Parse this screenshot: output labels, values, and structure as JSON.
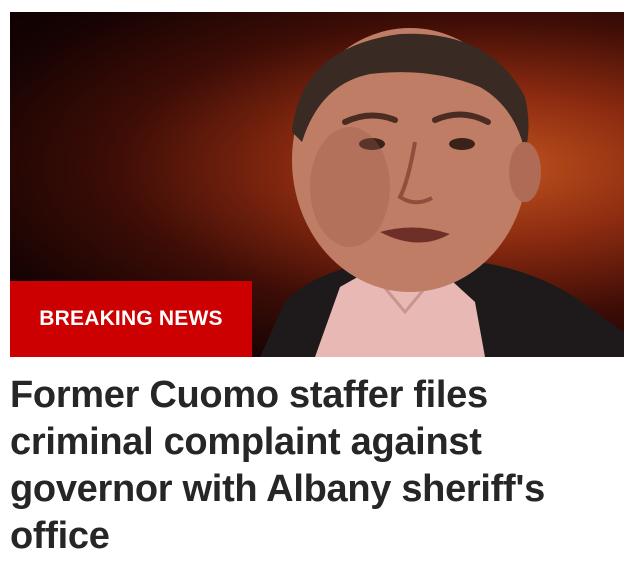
{
  "story": {
    "badge_label": "BREAKING NEWS",
    "headline": "Former Cuomo staffer files criminal complaint against governor with Albany sheriff's office",
    "image_icon": "news-photo"
  },
  "colors": {
    "badge_background": "#cc0000",
    "badge_text": "#ffffff",
    "headline_text": "#262626"
  }
}
